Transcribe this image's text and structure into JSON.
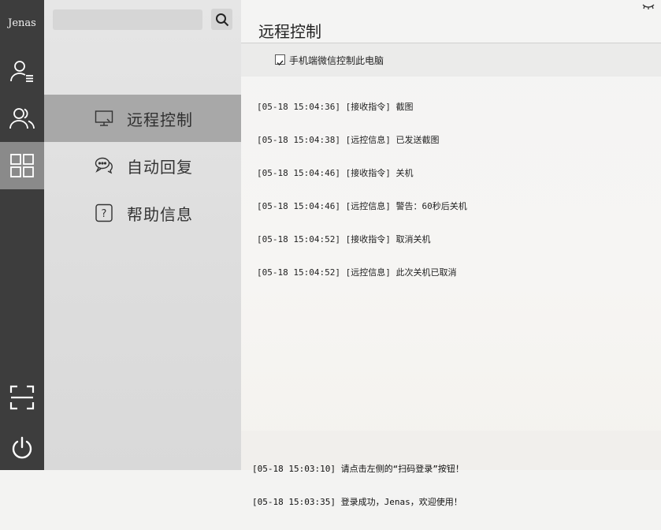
{
  "rail": {
    "username": "Jenas"
  },
  "nav": {
    "search_placeholder": "",
    "items": [
      {
        "label": "远程控制",
        "icon": "monitor-icon"
      },
      {
        "label": "自动回复",
        "icon": "chat-bubbles-icon"
      },
      {
        "label": "帮助信息",
        "icon": "help-icon"
      }
    ]
  },
  "main": {
    "title": "远程控制",
    "option": {
      "label": "手机端微信控制此电脑",
      "checked": true
    },
    "log": [
      "[05-18 15:04:36] [接收指令] 截图",
      "[05-18 15:04:38] [远控信息] 已发送截图",
      "[05-18 15:04:46] [接收指令] 关机",
      "[05-18 15:04:46] [远控信息] 警告：60秒后关机",
      "[05-18 15:04:52] [接收指令] 取消关机",
      "[05-18 15:04:52] [远控信息] 此次关机已取消"
    ],
    "status": [
      "[05-18 15:03:10] 请点击左侧的“扫码登录”按钮！",
      "[05-18 15:03:35] 登录成功，Jenas，欢迎使用！"
    ]
  },
  "colors": {
    "rail_bg": "#3d3d3d",
    "rail_active": "#8a8a8a",
    "nav_active": "#a8a8a8"
  }
}
